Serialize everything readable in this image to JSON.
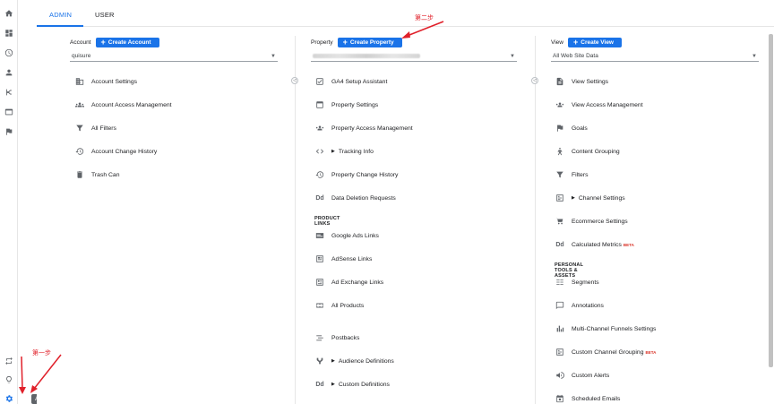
{
  "tabs": [
    {
      "label": "ADMIN"
    },
    {
      "label": "USER"
    }
  ],
  "tooltip": {
    "admin": "Admin"
  },
  "account": {
    "label": "Account",
    "create": "Create Account",
    "selected": "quisure",
    "items": [
      {
        "label": "Account Settings",
        "icon": "building-icon"
      },
      {
        "label": "Account Access Management",
        "icon": "people-icon"
      },
      {
        "label": "All Filters",
        "icon": "filter-icon"
      },
      {
        "label": "Account Change History",
        "icon": "history-icon"
      },
      {
        "label": "Trash Can",
        "icon": "trash-icon"
      }
    ]
  },
  "property": {
    "label": "Property",
    "create": "Create Property",
    "items": [
      {
        "label": "GA4 Setup Assistant",
        "icon": "checkbox-icon"
      },
      {
        "label": "Property Settings",
        "icon": "window-icon"
      },
      {
        "label": "Property Access Management",
        "icon": "people-icon"
      },
      {
        "label": "Tracking Info",
        "icon": "code-icon",
        "expandable": true
      },
      {
        "label": "Property Change History",
        "icon": "history-icon"
      },
      {
        "label": "Data Deletion Requests",
        "icon": "dd-icon"
      }
    ],
    "section": "PRODUCT LINKS",
    "links": [
      {
        "label": "Google Ads Links",
        "icon": "ads-icon"
      },
      {
        "label": "AdSense Links",
        "icon": "adsense-icon"
      },
      {
        "label": "Ad Exchange Links",
        "icon": "adexchange-icon"
      },
      {
        "label": "All Products",
        "icon": "products-icon"
      },
      {
        "label": "Postbacks",
        "icon": "postbacks-icon"
      },
      {
        "label": "Audience Definitions",
        "icon": "audience-icon",
        "expandable": true
      },
      {
        "label": "Custom Definitions",
        "icon": "dd-icon",
        "expandable": true
      }
    ]
  },
  "view": {
    "label": "View",
    "create": "Create View",
    "selected": "All Web Site Data",
    "items": [
      {
        "label": "View Settings",
        "icon": "document-icon"
      },
      {
        "label": "View Access Management",
        "icon": "people-icon"
      },
      {
        "label": "Goals",
        "icon": "flag-icon"
      },
      {
        "label": "Content Grouping",
        "icon": "person-run-icon"
      },
      {
        "label": "Filters",
        "icon": "filter-icon"
      },
      {
        "label": "Channel Settings",
        "icon": "channel-icon",
        "expandable": true
      },
      {
        "label": "Ecommerce Settings",
        "icon": "cart-icon"
      },
      {
        "label": "Calculated Metrics",
        "icon": "dd-icon",
        "beta": "BETA"
      }
    ],
    "section": "PERSONAL TOOLS & ASSETS",
    "tools": [
      {
        "label": "Segments",
        "icon": "segments-icon"
      },
      {
        "label": "Annotations",
        "icon": "comment-icon"
      },
      {
        "label": "Multi-Channel Funnels Settings",
        "icon": "bars-icon"
      },
      {
        "label": "Custom Channel Grouping",
        "icon": "channel-icon",
        "beta": "BETA"
      },
      {
        "label": "Custom Alerts",
        "icon": "megaphone-icon"
      },
      {
        "label": "Scheduled Emails",
        "icon": "calendar-icon"
      }
    ]
  },
  "annotations": {
    "step1": "第一步",
    "step2": "第二步"
  },
  "colors": {
    "accent": "#1a73e8",
    "annotation": "#e0202a"
  }
}
